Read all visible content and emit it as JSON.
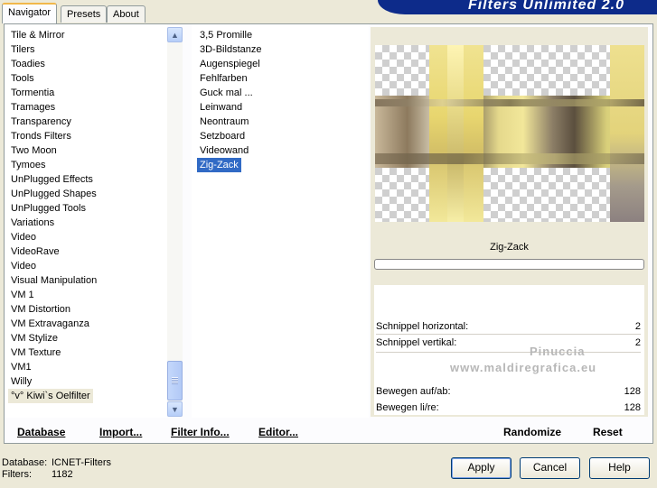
{
  "tabs": [
    {
      "label": "Navigator",
      "active": true
    },
    {
      "label": "Presets",
      "active": false
    },
    {
      "label": "About",
      "active": false
    }
  ],
  "banner_title": "Filters Unlimited 2.0",
  "categories": [
    "Tile & Mirror",
    "Tilers",
    "Toadies",
    "Tools",
    "Tormentia",
    "Tramages",
    "Transparency",
    "Tronds Filters",
    "Two Moon",
    "Tymoes",
    "UnPlugged Effects",
    "UnPlugged Shapes",
    "UnPlugged Tools",
    "Variations",
    "Video",
    "VideoRave",
    "Video",
    "Visual Manipulation",
    "VM 1",
    "VM Distortion",
    "VM Extravaganza",
    "VM Stylize",
    "VM Texture",
    "VM1",
    "Willy",
    "°v° Kiwi`s Oelfilter"
  ],
  "selected_category_index": 25,
  "filters": [
    "3,5 Promille",
    "3D-Bildstanze",
    "Augenspiegel",
    "Fehlfarben",
    "Guck mal ...",
    "Leinwand",
    "Neontraum",
    "Setzboard",
    "Videowand",
    "Zig-Zack"
  ],
  "selected_filter_index": 9,
  "preview": {
    "filter_name": "Zig-Zack"
  },
  "parameters": [
    {
      "label": "Schnippel horizontal:",
      "value": "2"
    },
    {
      "label": "Schnippel vertikal:",
      "value": "2"
    },
    {
      "label": "Bewegen auf/ab:",
      "value": "128"
    },
    {
      "label": "Bewegen li/re:",
      "value": "128"
    }
  ],
  "watermark": {
    "line1": "Pinuccia",
    "line2": "www.maldiregrafica.eu"
  },
  "bottom_bar": {
    "database": "Database",
    "import": "Import...",
    "filter_info": "Filter Info...",
    "editor": "Editor...",
    "randomize": "Randomize",
    "reset": "Reset"
  },
  "status": {
    "database_label": "Database:",
    "database_value": "ICNET-Filters",
    "filters_label": "Filters:",
    "filters_value": "1182"
  },
  "buttons": {
    "apply": "Apply",
    "cancel": "Cancel",
    "help": "Help"
  }
}
